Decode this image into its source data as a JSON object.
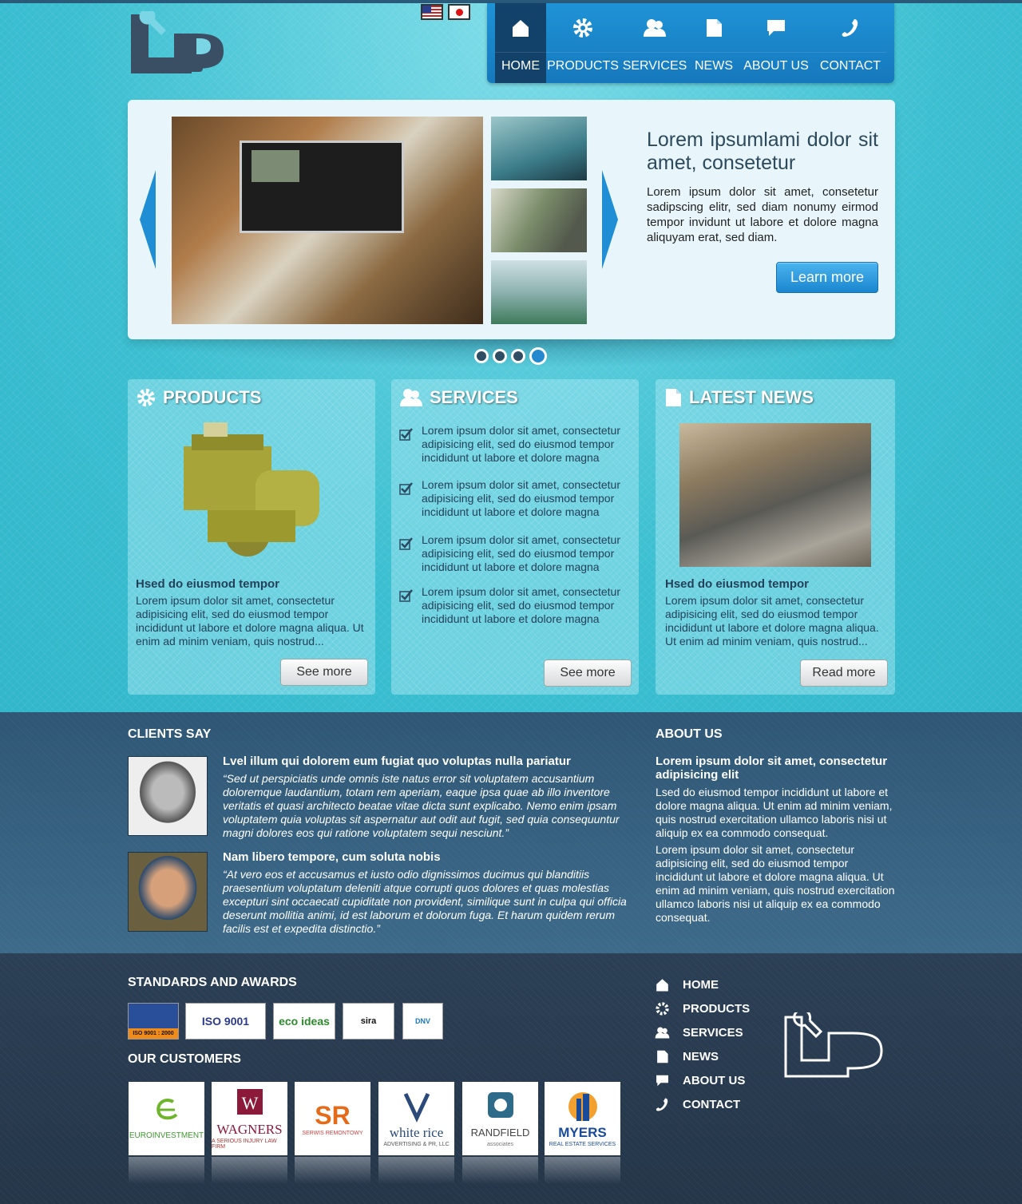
{
  "header": {
    "logo_alt": "LP",
    "flags": [
      "us-flag",
      "japan-flag"
    ]
  },
  "nav": {
    "items": [
      {
        "label": "HOME",
        "icon": "home-icon",
        "active": true
      },
      {
        "label": "PRODUCTS",
        "icon": "gear-icon",
        "active": false
      },
      {
        "label": "SERVICES",
        "icon": "users-icon",
        "active": false
      },
      {
        "label": "NEWS",
        "icon": "document-icon",
        "active": false
      },
      {
        "label": "ABOUT US",
        "icon": "speech-bubble-icon",
        "active": false
      },
      {
        "label": "CONTACT",
        "icon": "phone-icon",
        "active": false
      }
    ]
  },
  "slider": {
    "title": "Lorem ipsumlami dolor sit amet, consetetur",
    "text": "Lorem ipsum dolor sit amet, consetetur sadipscing elitr, sed diam nonumy eirmod tempor invidunt ut labore et dolore magna aliquyam erat, sed diam.",
    "button": "Learn more",
    "dots": 4,
    "active_dot": 4
  },
  "products": {
    "title": "PRODUCTS",
    "subtitle": "Hsed do eiusmod tempor",
    "text": "Lorem ipsum dolor sit amet, consectetur adipisicing elit, sed do eiusmod tempor incididunt ut labore et dolore magna aliqua. Ut enim ad minim veniam, quis nostrud...",
    "button": "See more"
  },
  "services": {
    "title": "SERVICES",
    "items": [
      "Lorem ipsum dolor sit amet, consectetur adipisicing elit, sed do eiusmod tempor incididunt ut labore et dolore magna",
      "Lorem ipsum dolor sit amet, consectetur adipisicing elit, sed do eiusmod tempor incididunt ut labore et dolore magna",
      "Lorem ipsum dolor sit amet, consectetur adipisicing elit, sed do eiusmod tempor incididunt ut labore et dolore magna",
      "Lorem ipsum dolor sit amet, consectetur adipisicing elit, sed do eiusmod tempor incididunt ut labore et dolore magna"
    ],
    "button": "See more"
  },
  "news": {
    "title": "LATEST NEWS",
    "subtitle": "Hsed do eiusmod tempor",
    "text": "Lorem ipsum dolor sit amet, consectetur adipisicing elit, sed do eiusmod tempor incididunt ut labore et dolore magna aliqua. Ut enim ad minim veniam, quis nostrud...",
    "button": "Read more"
  },
  "clients": {
    "title": "CLIENTS SAY",
    "quotes": [
      {
        "title": "Lvel illum qui dolorem eum fugiat quo voluptas nulla pariatur",
        "text": "“Sed ut perspiciatis unde omnis iste natus error sit voluptatem accusantium doloremque laudantium, totam rem aperiam, eaque ipsa quae ab illo inventore veritatis et quasi architecto beatae vitae dicta sunt explicabo. Nemo enim ipsam voluptatem quia voluptas sit aspernatur aut odit aut fugit, sed quia consequuntur magni dolores eos qui ratione voluptatem sequi nesciunt.”"
      },
      {
        "title": "Nam libero tempore, cum soluta nobis",
        "text": "“At vero eos et accusamus et iusto odio dignissimos ducimus qui blanditiis praesentium voluptatum deleniti atque corrupti quos dolores et quas molestias excepturi sint occaecati cupiditate non provident, similique sunt in culpa qui officia deserunt mollitia animi, id est laborum et dolorum fuga. Et harum quidem rerum facilis est et expedita distinctio.”"
      }
    ]
  },
  "about": {
    "title": "ABOUT US",
    "subtitle": "Lorem ipsum dolor sit amet, consectetur adipisicing elit",
    "p1": "Lsed do eiusmod tempor incididunt ut labore et dolore magna aliqua. Ut enim ad minim veniam, quis nostrud exercitation ullamco laboris nisi ut aliquip ex ea commodo consequat.",
    "p2": "Lorem ipsum dolor sit amet, consectetur adipisicing elit, sed do eiusmod tempor incididunt ut labore et dolore magna aliqua. Ut enim ad minim veniam, quis nostrud exercitation ullamco laboris nisi ut aliquip ex ea commodo consequat."
  },
  "footer": {
    "standards_title": "STANDARDS AND AWARDS",
    "badges": [
      "ISO 9001 : 2000",
      "ISO 9001",
      "eco ideas",
      "sira",
      "DNV"
    ],
    "customers_title": "OUR CUSTOMERS",
    "customers": [
      {
        "name": "EUROINVESTMENT",
        "small": ""
      },
      {
        "name": "WAGNERS",
        "small": "A SERIOUS INJURY LAW FIRM"
      },
      {
        "name": "SR",
        "small": "SERWIS REMONTOWY"
      },
      {
        "name": "white rice",
        "small": "ADVERTISING & PR, LLC"
      },
      {
        "name": "RANDFIELD",
        "small": "associates"
      },
      {
        "name": "MYERS",
        "small": "REAL ESTATE SERVICES"
      }
    ],
    "nav": [
      {
        "label": "HOME",
        "icon": "home-icon"
      },
      {
        "label": "PRODUCTS",
        "icon": "gear-icon"
      },
      {
        "label": "SERVICES",
        "icon": "users-icon"
      },
      {
        "label": "NEWS",
        "icon": "document-icon"
      },
      {
        "label": "ABOUT US",
        "icon": "speech-bubble-icon"
      },
      {
        "label": "CONTACT",
        "icon": "phone-icon"
      }
    ]
  },
  "colors": {
    "nav_blue": "#1f8ed4",
    "nav_active": "#12426a",
    "hero_cyan": "#3bbfd1",
    "clients_bg": "#355f7e",
    "footer_bg": "#283a4f"
  }
}
